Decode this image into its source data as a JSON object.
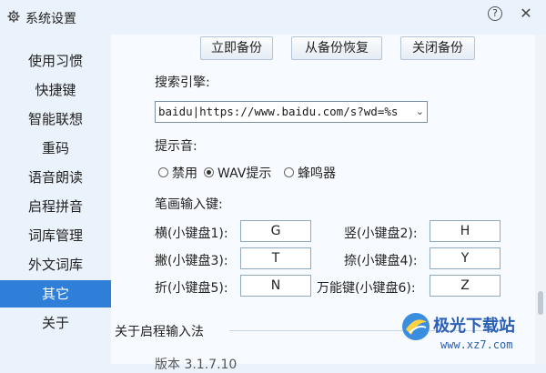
{
  "window": {
    "title": "系统设置",
    "help_glyph": "?",
    "close_glyph": "✕"
  },
  "sidebar": {
    "items": [
      {
        "label": "使用习惯"
      },
      {
        "label": "快捷键"
      },
      {
        "label": "智能联想"
      },
      {
        "label": "重码"
      },
      {
        "label": "语音朗读"
      },
      {
        "label": "启程拼音"
      },
      {
        "label": "词库管理"
      },
      {
        "label": "外文词库"
      },
      {
        "label": "其它",
        "active": true
      },
      {
        "label": "关于"
      }
    ],
    "active_color": "#2f7fd8"
  },
  "backup": {
    "backup_now": "立即备份",
    "restore": "从备份恢复",
    "close_backup": "关闭备份"
  },
  "search_engine": {
    "label": "搜索引擎:",
    "value": "baidu|https://www.baidu.com/s?wd=%s"
  },
  "sound": {
    "label": "提示音:",
    "options": [
      {
        "label": "禁用",
        "selected": false
      },
      {
        "label": "WAV提示",
        "selected": true
      },
      {
        "label": "蜂鸣器",
        "selected": false
      }
    ]
  },
  "stroke_keys": {
    "label": "笔画输入键:",
    "keys": [
      {
        "name": "横(小键盘1):",
        "value": "G"
      },
      {
        "name": "竖(小键盘2):",
        "value": "H"
      },
      {
        "name": "撇(小键盘3):",
        "value": "T"
      },
      {
        "name": "捺(小键盘4):",
        "value": "Y"
      },
      {
        "name": "折(小键盘5):",
        "value": "N"
      },
      {
        "name": "万能键(小键盘6):",
        "value": "Z"
      }
    ]
  },
  "about": {
    "heading": "关于启程输入法",
    "version_partial": "版本 3.1.7.10"
  },
  "watermark": {
    "brand": "极光下载站",
    "url": "www.xz7.com"
  }
}
